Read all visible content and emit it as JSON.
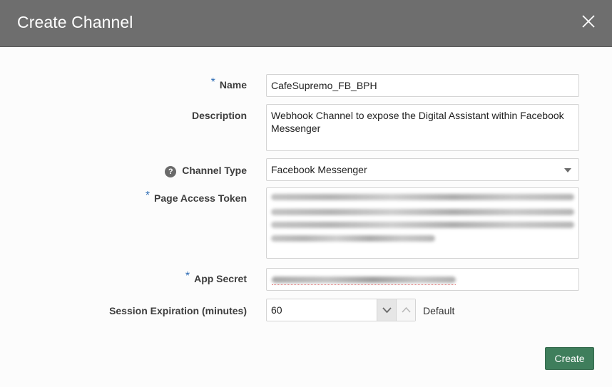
{
  "dialog": {
    "title": "Create Channel",
    "close_icon": "close-icon"
  },
  "form": {
    "name": {
      "label": "Name",
      "required": "*",
      "value": "CafeSupremo_FB_BPH"
    },
    "description": {
      "label": "Description",
      "value": "Webhook Channel to expose the Digital Assistant within Facebook Messenger"
    },
    "channel_type": {
      "label": "Channel Type",
      "help_icon": "?",
      "value": "Facebook Messenger"
    },
    "page_access_token": {
      "label": "Page Access Token",
      "required": "*"
    },
    "app_secret": {
      "label": "App Secret",
      "required": "*"
    },
    "session_expiration": {
      "label": "Session Expiration (minutes)",
      "value": "60",
      "default_label": "Default"
    }
  },
  "actions": {
    "create_label": "Create"
  },
  "colors": {
    "header": "#6e6e6e",
    "primary_button": "#3f7e5c",
    "required_marker": "#2f6db5"
  }
}
